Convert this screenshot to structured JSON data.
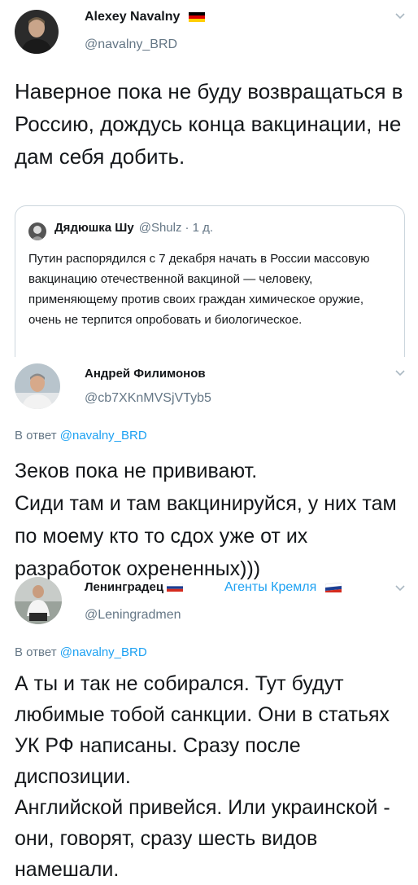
{
  "tweets": [
    {
      "name": "Alexey Navalny",
      "handle": "@navalny_BRD",
      "text": "Наверное пока не буду возвращаться в Россию, дождусь конца вакцинации, не дам себя добить.",
      "quote": {
        "name": "Дядюшка Шу",
        "handle": "@Shulz",
        "time": "· 1 д.",
        "text": "Путин распорядился с 7 декабря начать в России массовую вакцинацию отечественной вакциной — человеку, применяющему против своих граждан химическое оружие, очень не терпится опробовать и биологическое."
      }
    },
    {
      "name": "Андрей Филимонов",
      "handle": "@cb7XKnMVSjVTyb5",
      "reply_prefix": "В ответ ",
      "reply_handle": "@navalny_BRD",
      "text": "Зеков пока не прививают.\nСиди там и там вакцинируйся, у них там по моему кто то сдох уже от их разработок охрененных)))"
    },
    {
      "name": "Ленинградец",
      "handle": "@Leningradmen",
      "tag": "Агенты Кремля",
      "reply_prefix": "В ответ ",
      "reply_handle": "@navalny_BRD",
      "text": "А ты и так не собирался. Тут будут любимые тобой санкции. Они в статьях УК РФ написаны. Сразу после диспозиции.\nАнглийской привейся. Или украинской - они, говорят, сразу шесть видов намешали."
    }
  ],
  "icons": {
    "chevron": "chevron-down-icon",
    "flag_de": "flag-germany-icon",
    "flag_ru": "flag-russia-icon"
  }
}
